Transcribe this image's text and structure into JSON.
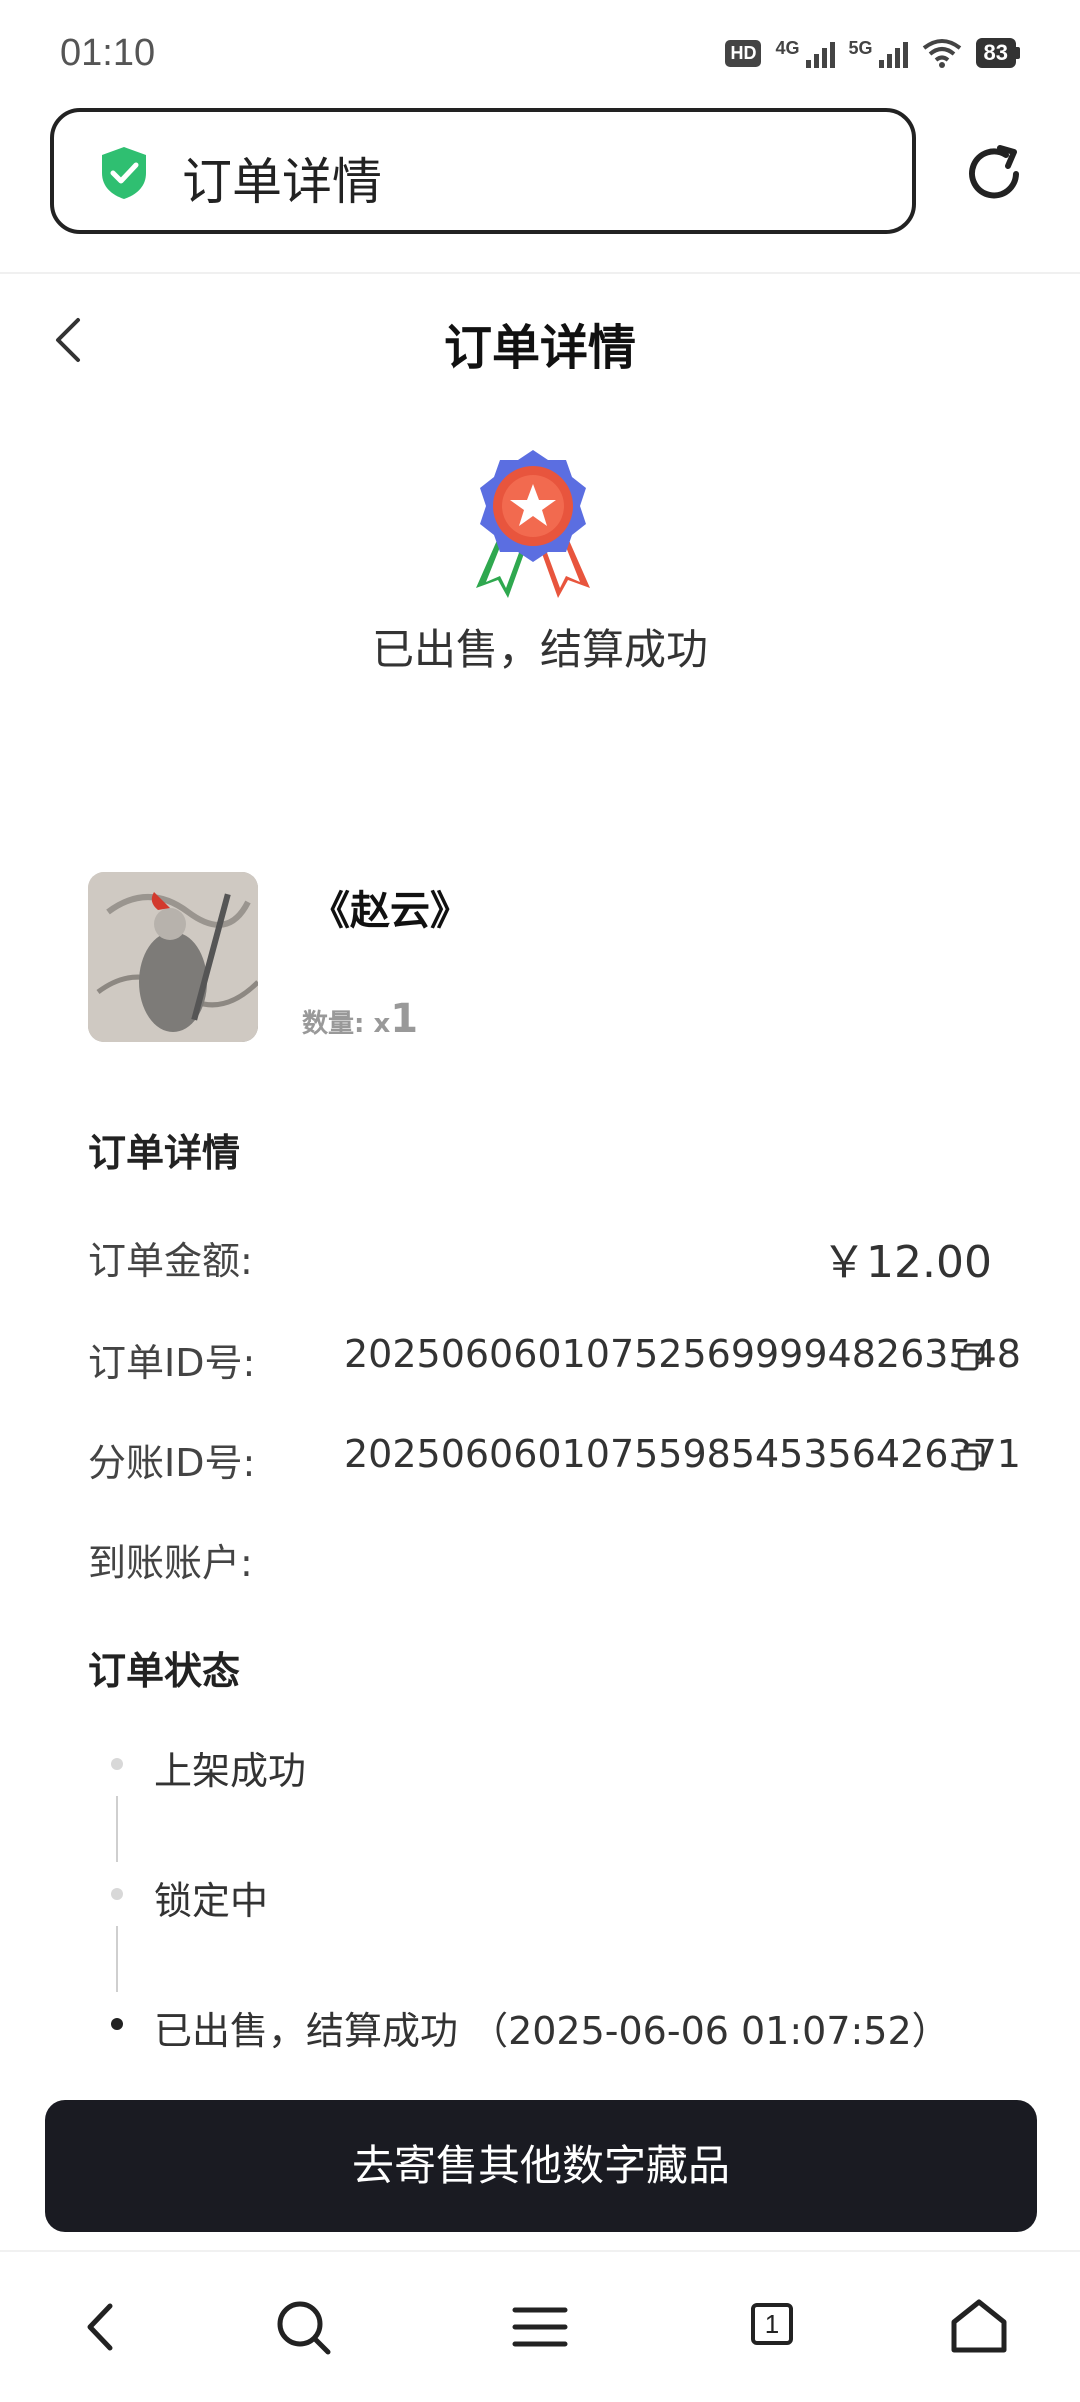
{
  "status_bar": {
    "time": "01:10",
    "hd_badge": "HD",
    "hd_sub": "2",
    "net1": "4G",
    "net2": "5G",
    "battery": "83"
  },
  "browser": {
    "url_title": "订单详情",
    "icons": [
      "shield-check-icon",
      "refresh-icon"
    ]
  },
  "header": {
    "title": "订单详情"
  },
  "order_status_banner": {
    "text": "已出售，结算成功",
    "icon": "medal-star-icon"
  },
  "product": {
    "name": "《赵云》",
    "quantity_label": "数量:",
    "quantity_prefix": "x",
    "quantity": "1"
  },
  "details": {
    "section_title": "订单详情",
    "rows": [
      {
        "label": "订单金额:",
        "value": "￥12.00"
      },
      {
        "label": "订单ID号:",
        "value": "20250606010752569999482635 48"
      },
      {
        "label": "分账ID号:",
        "value": "202506060107559854535642637 1"
      },
      {
        "label": "到账账户:",
        "value": ""
      }
    ]
  },
  "order_status": {
    "section_title": "订单状态",
    "steps": [
      {
        "text": "上架成功"
      },
      {
        "text": "锁定中"
      },
      {
        "text": "已出售，结算成功 （2025-06-06 01:07:52）"
      }
    ]
  },
  "action": {
    "button_label": "去寄售其他数字藏品"
  },
  "bottom_nav": {
    "tab_count": "1",
    "icons": [
      "back-icon",
      "search-icon",
      "menu-icon",
      "tabs-icon",
      "home-icon"
    ]
  },
  "colors": {
    "button_bg": "#1a1b22",
    "shield_green": "#2fbf71",
    "medal_red": "#e8553d",
    "medal_blue": "#5b6ee1"
  }
}
